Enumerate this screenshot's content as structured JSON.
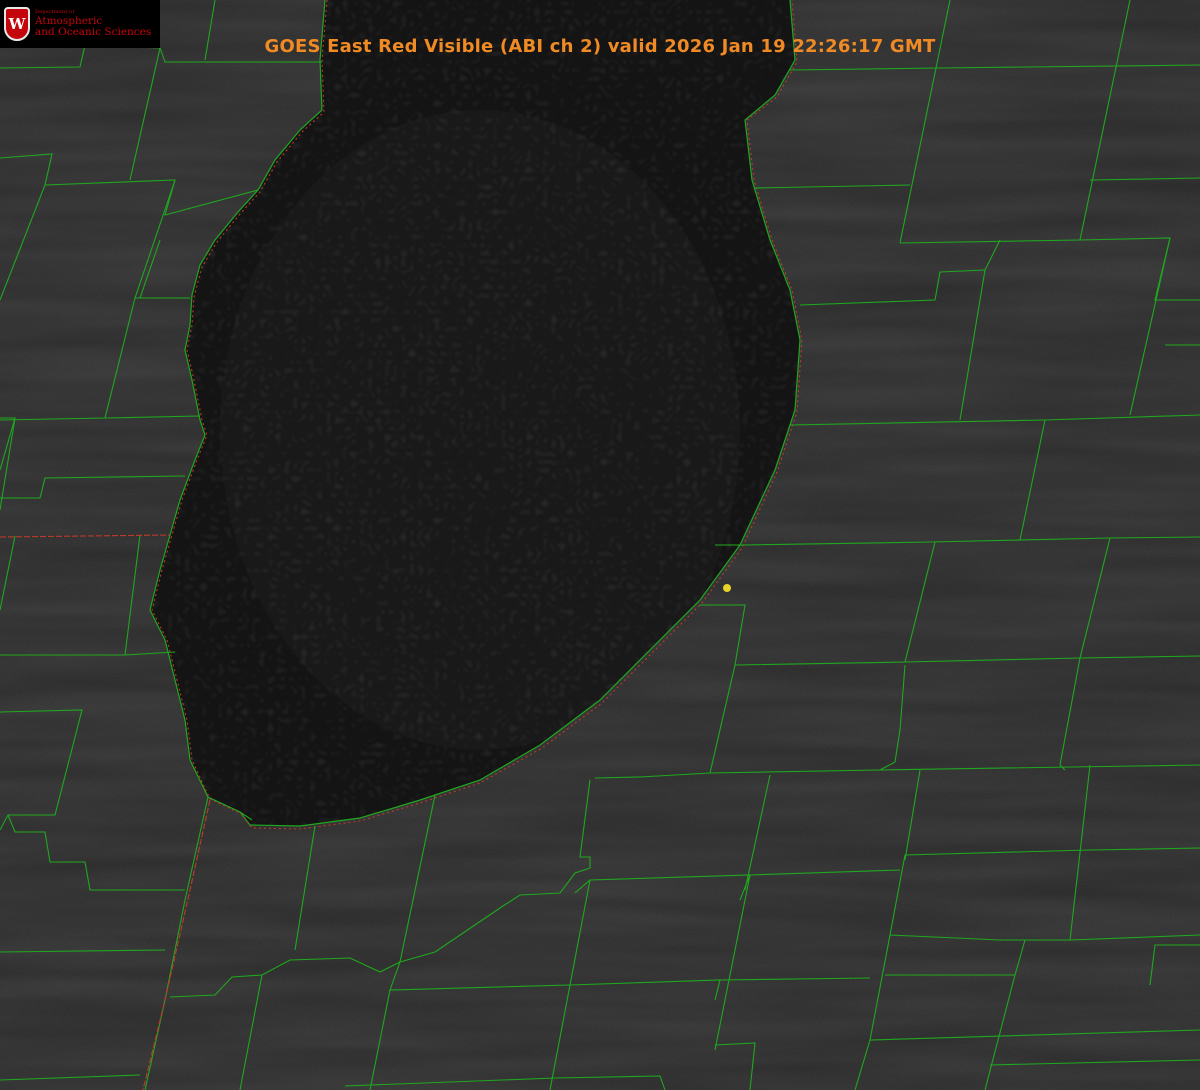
{
  "header": {
    "title": "GOES East Red Visible (ABI ch 2) valid 2026 Jan 19 22:26:17 GMT"
  },
  "logo": {
    "letter": "W",
    "small_text": "Department of",
    "line1": "Atmospheric",
    "line2": "and Oceanic Sciences"
  },
  "colors": {
    "land": "#242424",
    "lake": "#121212",
    "county_lines": "#1fa81f",
    "state_line": "#c0392b",
    "marker": "#e6d229",
    "title": "#f08a24",
    "logo_red": "#c5050c"
  },
  "map_features": {
    "lake": "Lake Michigan (southern basin)",
    "marker_icon": "location-dot-icon"
  }
}
